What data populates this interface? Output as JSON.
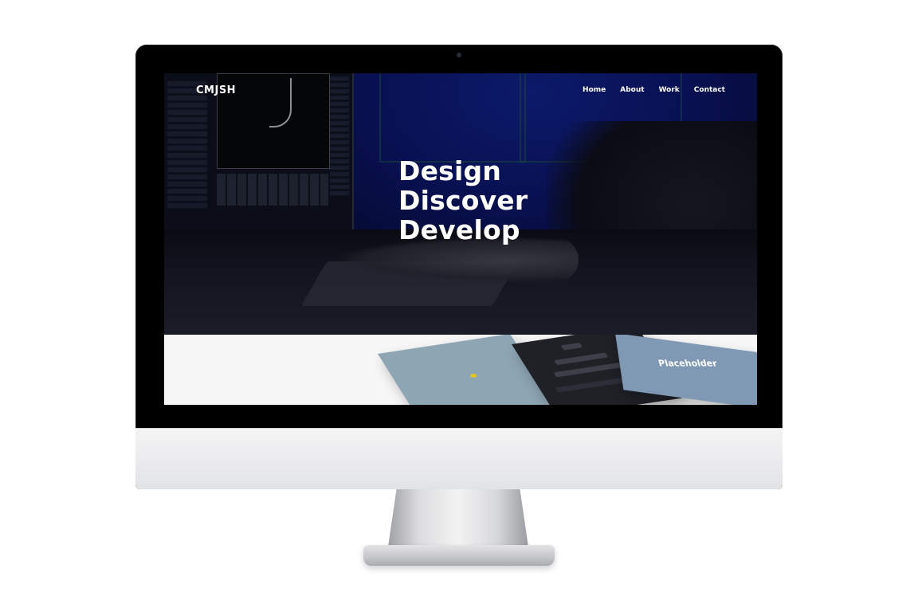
{
  "site": {
    "brand": "CMJSH",
    "nav": [
      {
        "label": "Home"
      },
      {
        "label": "About"
      },
      {
        "label": "Work"
      },
      {
        "label": "Contact"
      }
    ],
    "headline": [
      "Design",
      "Discover",
      "Develop"
    ]
  },
  "showcase": {
    "placeholder_label": "Placeholder"
  },
  "colors": {
    "hero_overlay": "#081050",
    "card_blue": "#8ea5b3",
    "card_dark": "#1f2127",
    "card_placeholder": "#7f98b3",
    "accent_yellow": "#e6c51b"
  }
}
